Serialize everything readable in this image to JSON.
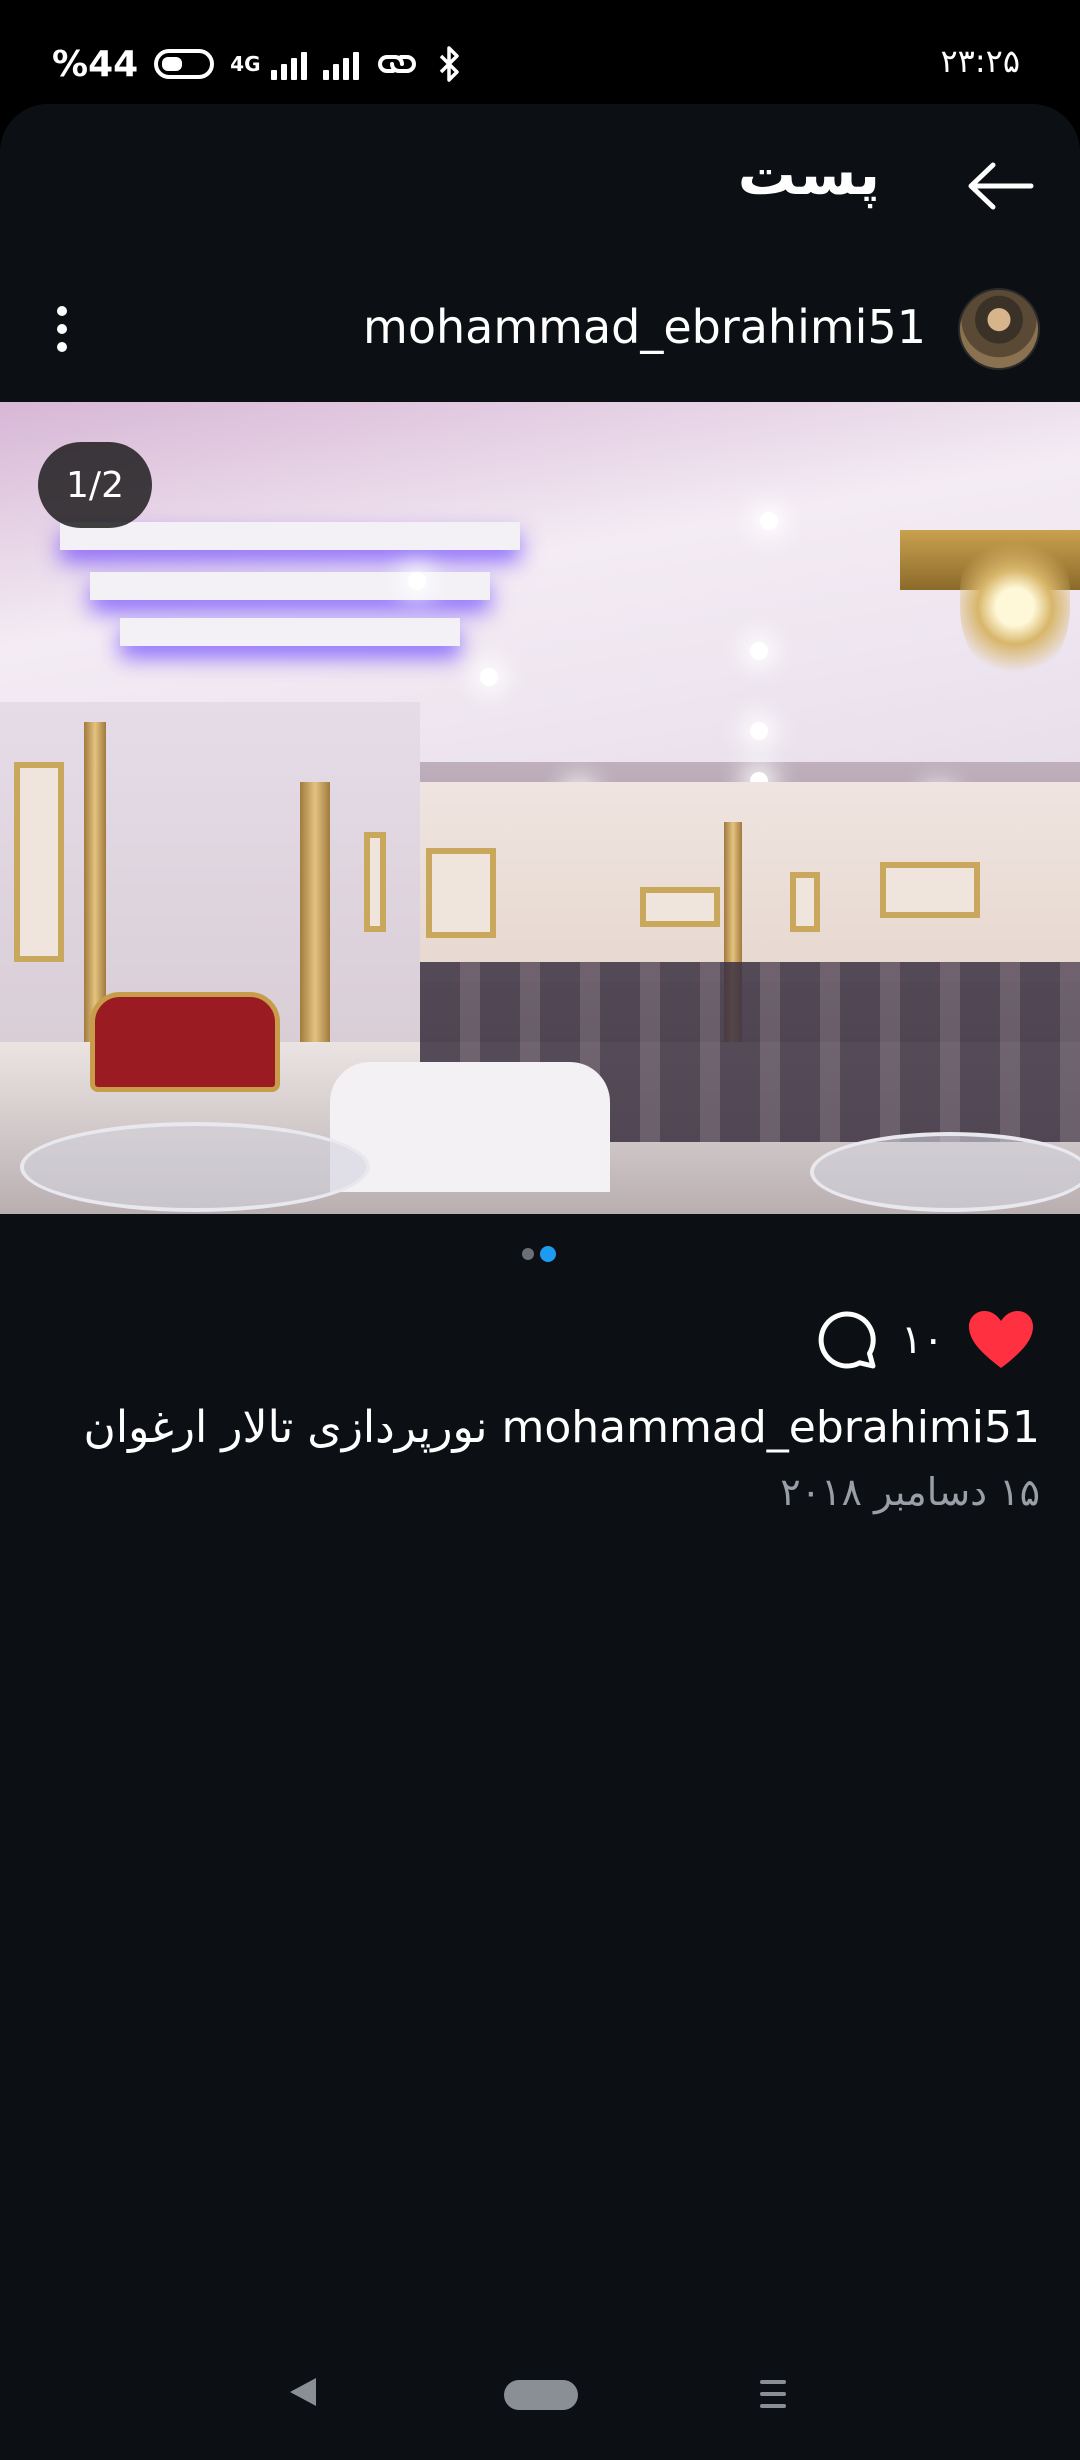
{
  "status_bar": {
    "battery_text": "%44",
    "network_type": "4G",
    "time": "۲۳:۲۵"
  },
  "header": {
    "title": "پست",
    "back_icon": "arrow-left-icon"
  },
  "post": {
    "username": "mohammad_ebrahimi51",
    "image_counter": "1/2",
    "images_total": 2,
    "current_image": 2,
    "likes": "۱۰",
    "caption_user": "mohammad_ebrahimi51",
    "caption_text": "نورپردازی تالار ارغوان",
    "date": "۱۵ دسامبر ۲۰۱۸"
  },
  "colors": {
    "background": "#0c1014",
    "like_heart": "#ff3040",
    "active_dot": "#1d9bf0",
    "secondary_text": "#9a9ea6"
  },
  "icons": {
    "more": "more-vertical-icon",
    "comment": "comment-bubble-icon",
    "like": "heart-icon"
  }
}
